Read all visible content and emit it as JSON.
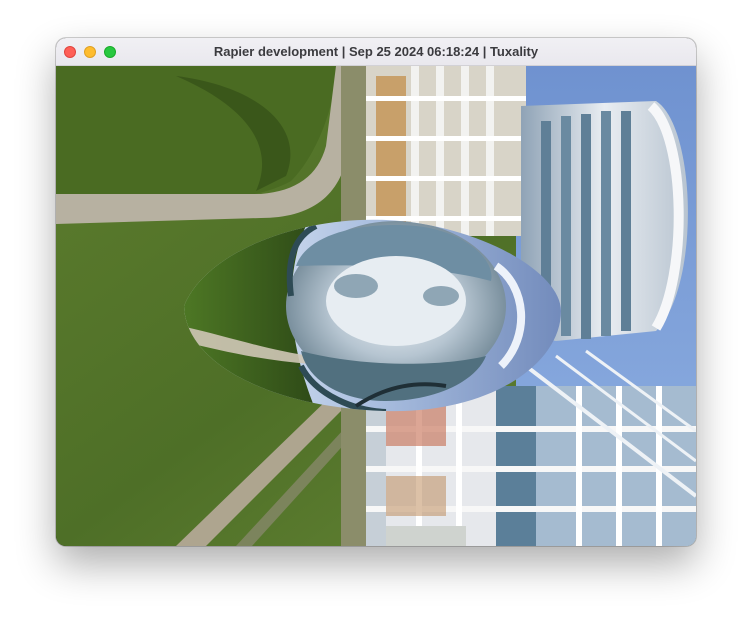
{
  "window": {
    "title": "Rapier development | Sep 25 2024 06:18:24 | Tuxality",
    "controls": [
      "close-button",
      "minimize-button",
      "zoom-button"
    ]
  },
  "scene": {
    "description_icon": "environment-mapped-egg",
    "colors": {
      "grass_dark": "#3f5f22",
      "grass_light": "#6f8f3a",
      "path": "#b9b3a3",
      "sky": "#7d9fd8",
      "building_white": "#e6e9ee",
      "glass": "#5d7f96",
      "chrome": "#c9d6e8"
    }
  }
}
